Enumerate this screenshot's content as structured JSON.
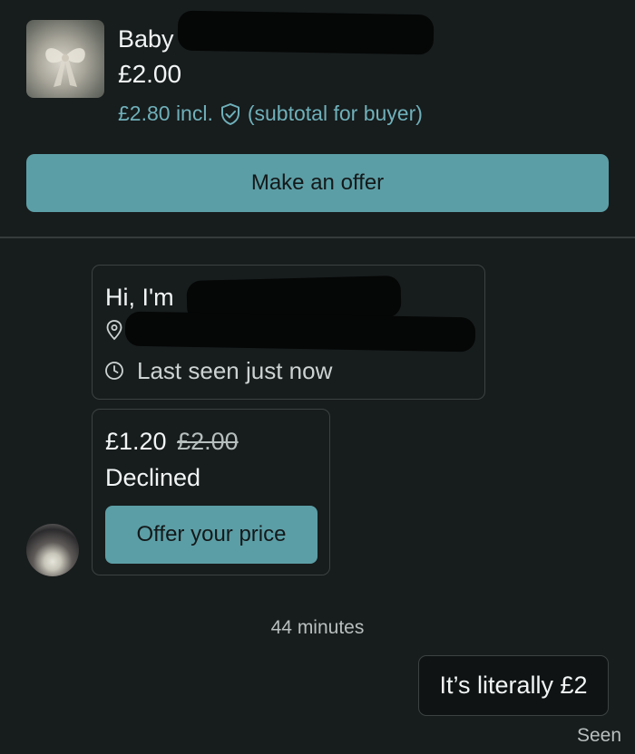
{
  "item": {
    "title": "Baby",
    "price": "£2.00",
    "buyer_price": "£2.80 incl.",
    "buyer_note": "(subtotal for buyer)",
    "make_offer_label": "Make an offer"
  },
  "profile": {
    "greeting": "Hi, I'm",
    "last_seen": "Last seen just now"
  },
  "offer": {
    "new_price": "£1.20",
    "old_price": "£2.00",
    "status": "Declined",
    "button_label": "Offer your price"
  },
  "chat": {
    "timestamp": "44 minutes",
    "message": "It’s literally £2",
    "seen": "Seen"
  },
  "colors": {
    "background": "#171c1c",
    "accent": "#5c9ea6",
    "link_text": "#6fb0ba",
    "border": "#3c4242"
  },
  "icons": [
    "shield-check-icon",
    "location-pin-icon",
    "clock-icon"
  ]
}
